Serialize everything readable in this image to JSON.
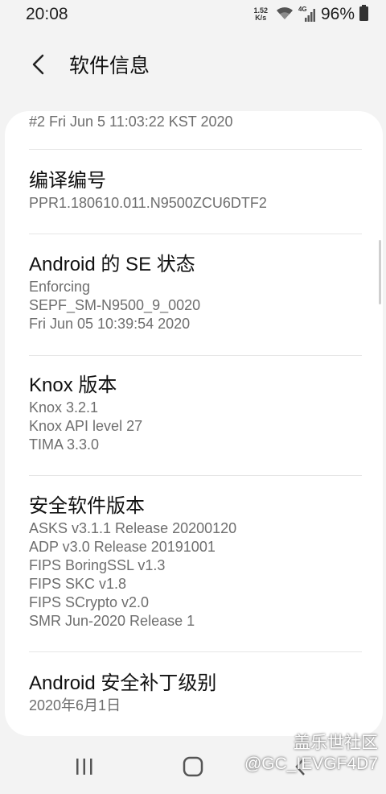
{
  "status_bar": {
    "time": "20:08",
    "net_speed_value": "1.52",
    "net_speed_unit": "K/s",
    "network_type": "4G",
    "battery": "96%"
  },
  "header": {
    "title": "软件信息"
  },
  "items": [
    {
      "title": "",
      "lines": [
        "#2 Fri Jun 5 11:03:22 KST 2020"
      ]
    },
    {
      "title": "编译编号",
      "lines": [
        "PPR1.180610.011.N9500ZCU6DTF2"
      ]
    },
    {
      "title": "Android 的 SE 状态",
      "lines": [
        "Enforcing",
        "SEPF_SM-N9500_9_0020",
        "Fri Jun 05 10:39:54 2020"
      ]
    },
    {
      "title": "Knox 版本",
      "lines": [
        "Knox 3.2.1",
        "Knox API level 27",
        "TIMA 3.3.0"
      ]
    },
    {
      "title": "安全软件版本",
      "lines": [
        "ASKS v3.1.1 Release 20200120",
        "ADP v3.0 Release 20191001",
        "FIPS BoringSSL v1.3",
        "FIPS SKC v1.8",
        "FIPS SCrypto v2.0",
        "SMR Jun-2020 Release 1"
      ]
    },
    {
      "title": "Android 安全补丁级别",
      "lines": [
        "2020年6月1日"
      ]
    }
  ],
  "watermark": {
    "brand": "盖乐世社区",
    "user": "@GC_IEVGF4D7"
  },
  "colors": {
    "background": "#f3f3f3",
    "card": "#ffffff",
    "title_text": "#111111",
    "sub_text": "#6e6e6e"
  }
}
